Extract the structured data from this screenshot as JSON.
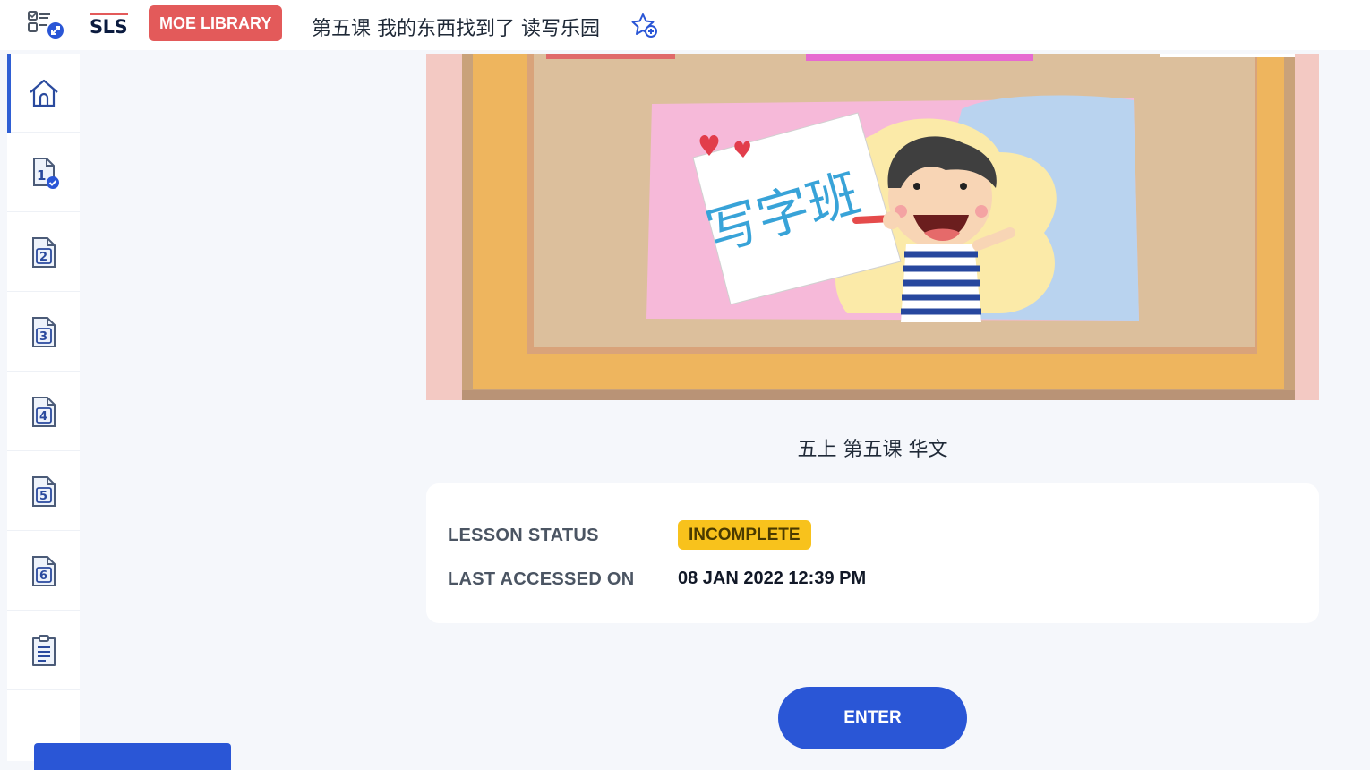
{
  "header": {
    "app_logo_text": "SLS",
    "library_badge": "MOE LIBRARY",
    "lesson_title": "第五课 我的东西找到了 读写乐园"
  },
  "sidebar": {
    "items": [
      {
        "icon": "home-icon"
      },
      {
        "icon": "page-1-completed-icon",
        "number": "1"
      },
      {
        "icon": "page-2-icon",
        "number": "2"
      },
      {
        "icon": "page-3-icon",
        "number": "3"
      },
      {
        "icon": "page-4-icon",
        "number": "4"
      },
      {
        "icon": "page-5-icon",
        "number": "5"
      },
      {
        "icon": "page-6-icon",
        "number": "6"
      },
      {
        "icon": "document-list-icon"
      }
    ]
  },
  "banner": {
    "image": "cartoon-boy-calligraphy-class-banner",
    "handwritten_text": "写字班"
  },
  "lesson": {
    "caption": "五上 第五课 华文",
    "status_label": "LESSON STATUS",
    "status_value": "INCOMPLETE",
    "last_accessed_label": "LAST ACCESSED ON",
    "last_accessed_value": "08 JAN 2022 12:39 PM"
  },
  "actions": {
    "enter_label": "ENTER"
  },
  "colors": {
    "primary": "#2a56d6",
    "library_badge": "#e35a5a",
    "status_badge": "#f8c21c",
    "background": "#f5f7fb"
  }
}
